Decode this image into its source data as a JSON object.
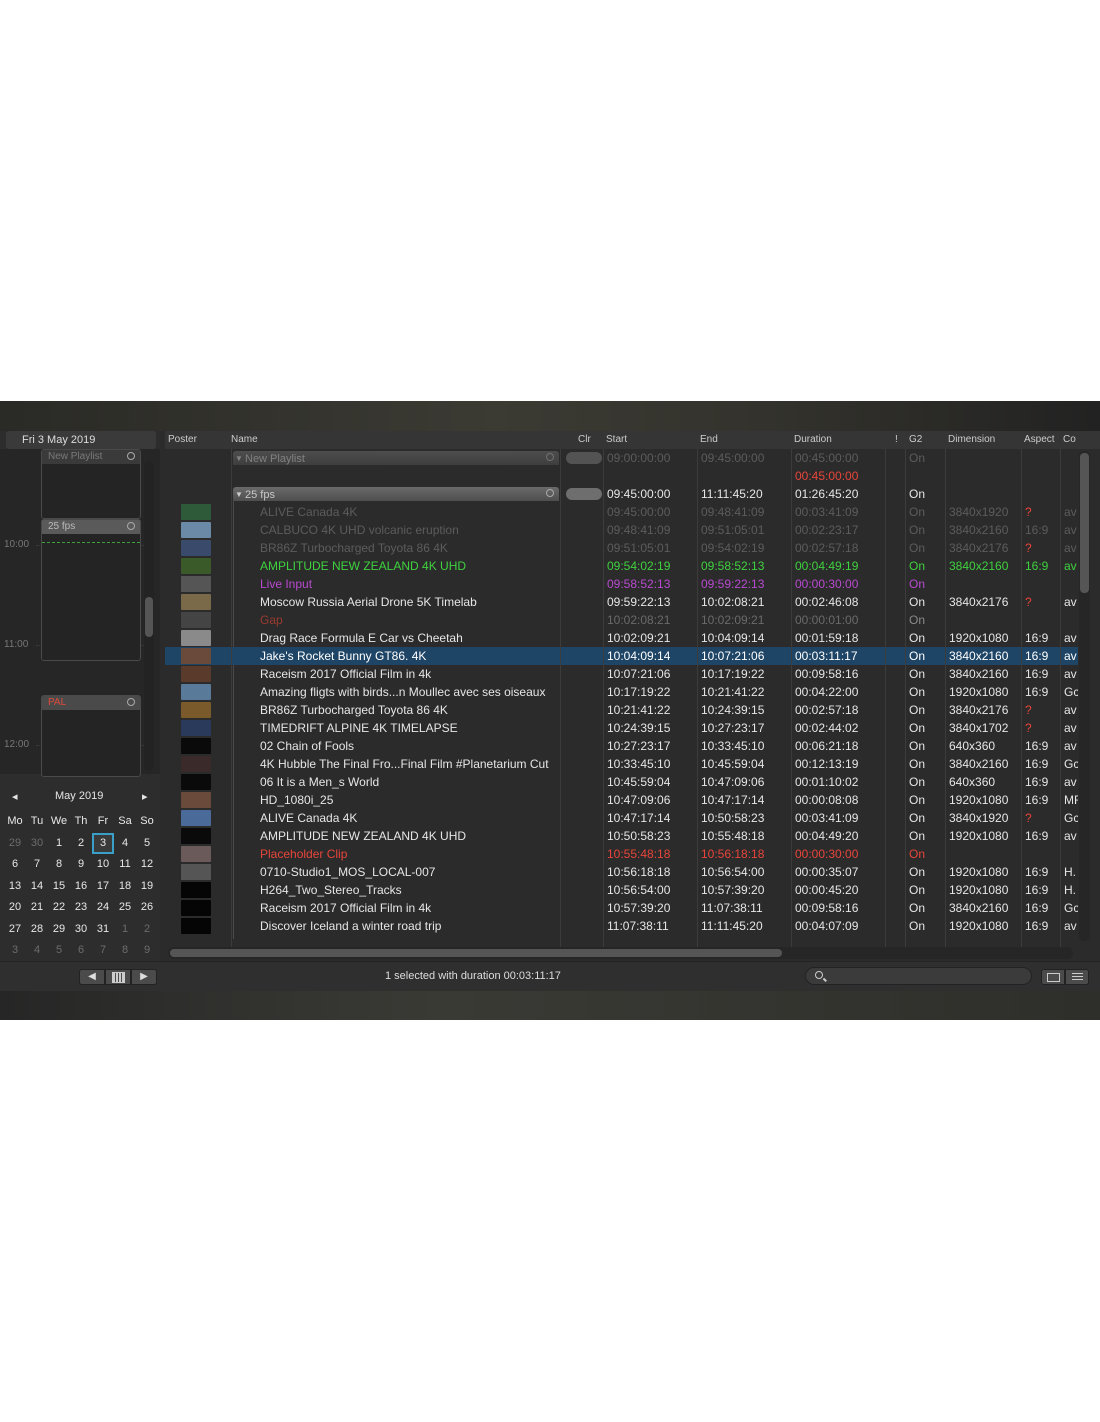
{
  "left_panel": {
    "date_header": "Fri 3 May 2019",
    "timeline": {
      "times": [
        "10:00",
        "11:00",
        "12:00"
      ],
      "blocks": [
        {
          "label": "New Playlist",
          "style": "dim"
        },
        {
          "label": "25 fps",
          "style": "normal"
        },
        {
          "label": "PAL",
          "style": "pal"
        }
      ]
    },
    "calendar": {
      "prev": "◂",
      "next": "▸",
      "month_label": "May 2019",
      "weekdays": [
        "Mo",
        "Tu",
        "We",
        "Th",
        "Fr",
        "Sa",
        "So"
      ],
      "weeks": [
        [
          "29",
          "30",
          "1",
          "2",
          "3",
          "4",
          "5"
        ],
        [
          "6",
          "7",
          "8",
          "9",
          "10",
          "11",
          "12"
        ],
        [
          "13",
          "14",
          "15",
          "16",
          "17",
          "18",
          "19"
        ],
        [
          "20",
          "21",
          "22",
          "23",
          "24",
          "25",
          "26"
        ],
        [
          "27",
          "28",
          "29",
          "30",
          "31",
          "1",
          "2"
        ],
        [
          "3",
          "4",
          "5",
          "6",
          "7",
          "8",
          "9"
        ]
      ],
      "selected": "3"
    }
  },
  "columns": [
    "Poster",
    "Name",
    "Clr",
    "Start",
    "End",
    "Duration",
    "!",
    "G2",
    "Dimension",
    "Aspect",
    "Co"
  ],
  "groups": [
    {
      "title": "New Playlist",
      "start": "09:00:00:00",
      "end": "09:45:00:00",
      "duration": "00:45:00:00",
      "g2": "On",
      "extra_duration": "00:45:00:00"
    },
    {
      "title": "25 fps",
      "start": "09:45:00:00",
      "end": "11:11:45:20",
      "duration": "01:26:45:20",
      "g2": "On"
    }
  ],
  "rows": [
    {
      "name": "ALIVE   Canada 4K",
      "start": "09:45:00:00",
      "end": "09:48:41:09",
      "duration": "00:03:41:09",
      "g2": "On",
      "dim": "3840x1920",
      "aspect": "?",
      "co": "av",
      "state": "dim",
      "thumb": "#2f5a3a"
    },
    {
      "name": "CALBUCO   4K UHD volcanic eruption",
      "start": "09:48:41:09",
      "end": "09:51:05:01",
      "duration": "00:02:23:17",
      "g2": "On",
      "dim": "3840x2160",
      "aspect": "16:9",
      "co": "av",
      "state": "dim",
      "thumb": "#6a8aa8"
    },
    {
      "name": "BR86Z Turbocharged Toyota 86 4K",
      "start": "09:51:05:01",
      "end": "09:54:02:19",
      "duration": "00:02:57:18",
      "g2": "On",
      "dim": "3840x2176",
      "aspect": "?",
      "co": "av",
      "state": "dim",
      "thumb": "#3a4a6a"
    },
    {
      "name": "AMPLITUDE   NEW ZEALAND 4K UHD",
      "start": "09:54:02:19",
      "end": "09:58:52:13",
      "duration": "00:04:49:19",
      "g2": "On",
      "dim": "3840x2160",
      "aspect": "16:9",
      "co": "av",
      "state": "green",
      "thumb": "#3a5a2a"
    },
    {
      "name": "Live Input",
      "start": "09:58:52:13",
      "end": "09:59:22:13",
      "duration": "00:00:30:00",
      "g2": "On",
      "dim": "",
      "aspect": "",
      "co": "",
      "state": "purple",
      "thumb": "#555555"
    },
    {
      "name": "Moscow Russia Aerial Drone 5K Timelab",
      "start": "09:59:22:13",
      "end": "10:02:08:21",
      "duration": "00:02:46:08",
      "g2": "On",
      "dim": "3840x2176",
      "aspect": "?",
      "co": "av",
      "state": "normal",
      "thumb": "#7a6a4a"
    },
    {
      "name": "Gap",
      "start": "10:02:08:21",
      "end": "10:02:09:21",
      "duration": "00:00:01:00",
      "g2": "On",
      "dim": "",
      "aspect": "",
      "co": "",
      "state": "gap",
      "thumb": "#444444"
    },
    {
      "name": "Drag Race  Formula E Car vs Cheetah",
      "start": "10:02:09:21",
      "end": "10:04:09:14",
      "duration": "00:01:59:18",
      "g2": "On",
      "dim": "1920x1080",
      "aspect": "16:9",
      "co": "av",
      "state": "normal",
      "thumb": "#8a8a8a"
    },
    {
      "name": "Jake's Rocket Bunny GT86.   4K",
      "start": "10:04:09:14",
      "end": "10:07:21:06",
      "duration": "00:03:11:17",
      "g2": "On",
      "dim": "3840x2160",
      "aspect": "16:9",
      "co": "av",
      "state": "selected",
      "thumb": "#6a4a3a"
    },
    {
      "name": "Raceism 2017 Official Film in 4k",
      "start": "10:07:21:06",
      "end": "10:17:19:22",
      "duration": "00:09:58:16",
      "g2": "On",
      "dim": "3840x2160",
      "aspect": "16:9",
      "co": "av",
      "state": "normal",
      "thumb": "#5a3a2a"
    },
    {
      "name": "Amazing fligts with birds...n Moullec avec ses oiseaux",
      "start": "10:17:19:22",
      "end": "10:21:41:22",
      "duration": "00:04:22:00",
      "g2": "On",
      "dim": "1920x1080",
      "aspect": "16:9",
      "co": "Gc",
      "state": "normal",
      "thumb": "#5a7a9a"
    },
    {
      "name": "BR86Z Turbocharged Toyota 86 4K",
      "start": "10:21:41:22",
      "end": "10:24:39:15",
      "duration": "00:02:57:18",
      "g2": "On",
      "dim": "3840x2176",
      "aspect": "?",
      "co": "av",
      "state": "normal",
      "thumb": "#7a5a2a"
    },
    {
      "name": "TIMEDRIFT   ALPINE 4K TIMELAPSE",
      "start": "10:24:39:15",
      "end": "10:27:23:17",
      "duration": "00:02:44:02",
      "g2": "On",
      "dim": "3840x1702",
      "aspect": "?",
      "co": "av",
      "state": "normal",
      "thumb": "#2a3a5a"
    },
    {
      "name": "02 Chain of Fools",
      "start": "10:27:23:17",
      "end": "10:33:45:10",
      "duration": "00:06:21:18",
      "g2": "On",
      "dim": "640x360",
      "aspect": "16:9",
      "co": "av",
      "state": "normal",
      "thumb": "#0a0a0a"
    },
    {
      "name": "4K   Hubble The Final Fro...Final Film #Planetarium Cut",
      "start": "10:33:45:10",
      "end": "10:45:59:04",
      "duration": "00:12:13:19",
      "g2": "On",
      "dim": "3840x2160",
      "aspect": "16:9",
      "co": "Gc",
      "state": "normal",
      "thumb": "#3a2a2a"
    },
    {
      "name": "06 It is a Men_s World",
      "start": "10:45:59:04",
      "end": "10:47:09:06",
      "duration": "00:01:10:02",
      "g2": "On",
      "dim": "640x360",
      "aspect": "16:9",
      "co": "av",
      "state": "normal",
      "thumb": "#0a0a0a"
    },
    {
      "name": "HD_1080i_25",
      "start": "10:47:09:06",
      "end": "10:47:17:14",
      "duration": "00:00:08:08",
      "g2": "On",
      "dim": "1920x1080",
      "aspect": "16:9",
      "co": "MF",
      "state": "normal",
      "thumb": "#6a4a3a"
    },
    {
      "name": "ALIVE   Canada 4K",
      "start": "10:47:17:14",
      "end": "10:50:58:23",
      "duration": "00:03:41:09",
      "g2": "On",
      "dim": "3840x1920",
      "aspect": "?",
      "co": "Gc",
      "state": "normal",
      "thumb": "#4a6a9a"
    },
    {
      "name": "AMPLITUDE   NEW ZEALAND 4K UHD",
      "start": "10:50:58:23",
      "end": "10:55:48:18",
      "duration": "00:04:49:20",
      "g2": "On",
      "dim": "1920x1080",
      "aspect": "16:9",
      "co": "av",
      "state": "normal",
      "thumb": "#0a0a0a"
    },
    {
      "name": "Placeholder Clip",
      "start": "10:55:48:18",
      "end": "10:56:18:18",
      "duration": "00:00:30:00",
      "g2": "On",
      "dim": "",
      "aspect": "",
      "co": "",
      "state": "red",
      "thumb": "#6a5a5a"
    },
    {
      "name": "0710-Studio1_MOS_LOCAL-007",
      "start": "10:56:18:18",
      "end": "10:56:54:00",
      "duration": "00:00:35:07",
      "g2": "On",
      "dim": "1920x1080",
      "aspect": "16:9",
      "co": "H.",
      "state": "normal",
      "thumb": "#555555"
    },
    {
      "name": "H264_Two_Stereo_Tracks",
      "start": "10:56:54:00",
      "end": "10:57:39:20",
      "duration": "00:00:45:20",
      "g2": "On",
      "dim": "1920x1080",
      "aspect": "16:9",
      "co": "H.",
      "state": "normal",
      "thumb": "#050505"
    },
    {
      "name": "Raceism 2017 Official Film in 4k",
      "start": "10:57:39:20",
      "end": "11:07:38:11",
      "duration": "00:09:58:16",
      "g2": "On",
      "dim": "3840x2160",
      "aspect": "16:9",
      "co": "Gc",
      "state": "normal",
      "thumb": "#050505"
    },
    {
      "name": "Discover Iceland   a winter road trip",
      "start": "11:07:38:11",
      "end": "11:11:45:20",
      "duration": "00:04:07:09",
      "g2": "On",
      "dim": "1920x1080",
      "aspect": "16:9",
      "co": "av",
      "state": "normal",
      "thumb": "#050505"
    }
  ],
  "status": {
    "text": "1 selected with duration 00:03:11:17",
    "search_placeholder": "",
    "nav_prev": "◀",
    "nav_next": "▶"
  },
  "colors": {
    "green": "#3fd23f",
    "purple": "#b84ad0",
    "red": "#e8453a",
    "selected_row": "#1e4566",
    "dim_text": "#5c5c5c"
  }
}
